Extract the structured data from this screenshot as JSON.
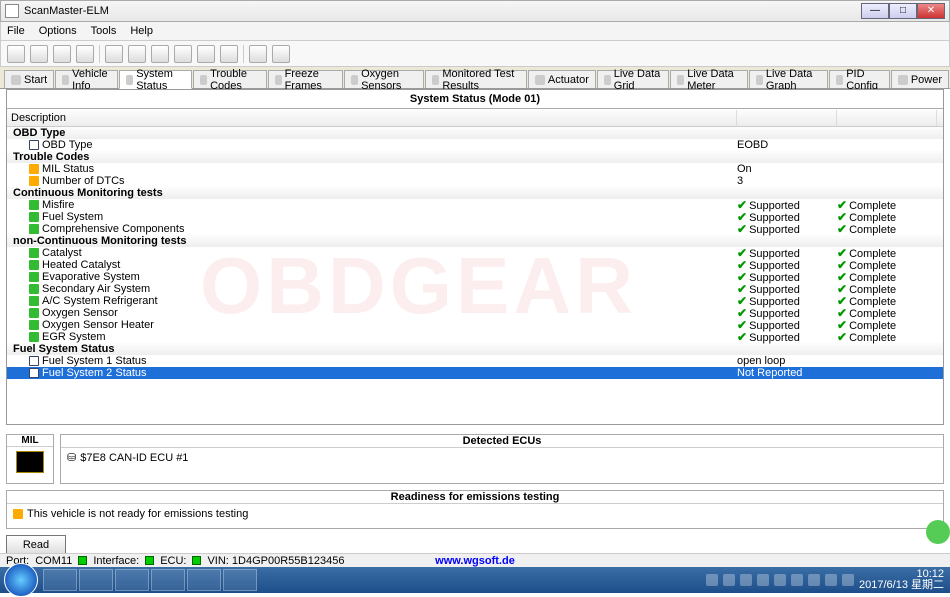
{
  "window": {
    "title": "ScanMaster-ELM"
  },
  "menu": {
    "file": "File",
    "options": "Options",
    "tools": "Tools",
    "help": "Help"
  },
  "tabs": {
    "start": "Start",
    "vehicle": "Vehicle Info",
    "systemstatus": "System Status",
    "trouble": "Trouble Codes",
    "freeze": "Freeze Frames",
    "oxygen": "Oxygen Sensors",
    "monitored": "Monitored Test Results",
    "actuator": "Actuator",
    "livegrid": "Live Data Grid",
    "livemeter": "Live Data Meter",
    "livegraph": "Live Data Graph",
    "pid": "PID Config",
    "power": "Power"
  },
  "panel": {
    "title": "System Status (Mode 01)",
    "col_desc": "Description"
  },
  "sections": {
    "obd": "OBD Type",
    "tc": "Trouble Codes",
    "cm": "Continuous Monitoring tests",
    "ncm": "non-Continuous Monitoring tests",
    "fss": "Fuel System Status"
  },
  "rows": {
    "obdtype": {
      "label": "OBD Type",
      "val": "EOBD"
    },
    "milstatus": {
      "label": "MIL Status",
      "val": "On"
    },
    "numdtc": {
      "label": "Number of DTCs",
      "val": "3"
    },
    "misfire": {
      "label": "Misfire",
      "v2": "Supported",
      "v3": "Complete"
    },
    "fuel": {
      "label": "Fuel System",
      "v2": "Supported",
      "v3": "Complete"
    },
    "cc": {
      "label": "Comprehensive Components",
      "v2": "Supported",
      "v3": "Complete"
    },
    "cat": {
      "label": "Catalyst",
      "v2": "Supported",
      "v3": "Complete"
    },
    "hcat": {
      "label": "Heated Catalyst",
      "v2": "Supported",
      "v3": "Complete"
    },
    "evap": {
      "label": "Evaporative System",
      "v2": "Supported",
      "v3": "Complete"
    },
    "secair": {
      "label": "Secondary Air System",
      "v2": "Supported",
      "v3": "Complete"
    },
    "ac": {
      "label": "A/C System Refrigerant",
      "v2": "Supported",
      "v3": "Complete"
    },
    "oxy": {
      "label": "Oxygen Sensor",
      "v2": "Supported",
      "v3": "Complete"
    },
    "oxyh": {
      "label": "Oxygen Sensor Heater",
      "v2": "Supported",
      "v3": "Complete"
    },
    "egr": {
      "label": "EGR System",
      "v2": "Supported",
      "v3": "Complete"
    },
    "fs1": {
      "label": "Fuel System 1 Status",
      "val": "open loop"
    },
    "fs2": {
      "label": "Fuel System 2 Status",
      "val": "Not Reported"
    }
  },
  "mil": {
    "label": "MIL"
  },
  "ecu": {
    "title": "Detected ECUs",
    "row1": "$7E8   CAN-ID ECU #1"
  },
  "emi": {
    "title": "Readiness for emissions testing",
    "msg": "This vehicle is not ready for emissions testing"
  },
  "read": {
    "label": "Read"
  },
  "status": {
    "port": "Port:",
    "portval": "COM11",
    "if": "Interface:",
    "ecu": "ECU:",
    "vin": "VIN: 1D4GP00R55B123456",
    "url": "www.wgsoft.de"
  },
  "clock": {
    "time": "10:12",
    "date": "2017/6/13 星期二"
  },
  "wm": "OBDGEAR"
}
